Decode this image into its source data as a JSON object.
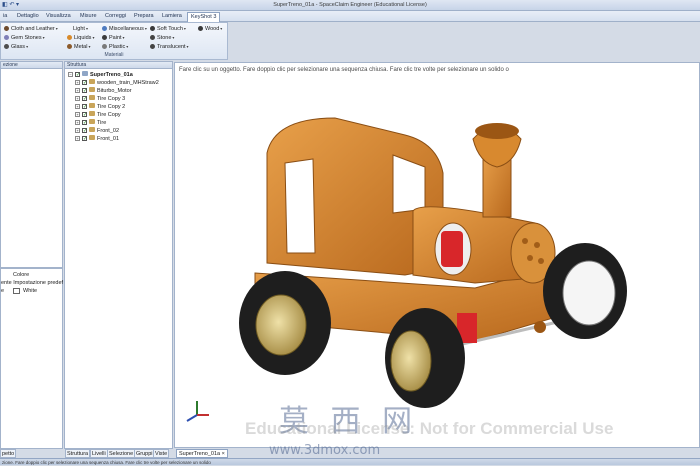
{
  "window": {
    "title": "SuperTreno_01a - SpaceClaim Engineer (Educational License)"
  },
  "menu": {
    "tabs": [
      "Dettaglio",
      "Visualizza",
      "Misure",
      "Correggi",
      "Prepara",
      "Lamiera",
      "KeyShot 3"
    ],
    "cut_left": "ia"
  },
  "ribbon": {
    "group_label": "Materiali",
    "materials": [
      {
        "label": "Cloth and Leather",
        "color": "#6e4a2c"
      },
      {
        "label": "Light",
        "color": ""
      },
      {
        "label": "Miscellaneous",
        "color": "#4f7cc0"
      },
      {
        "label": "Soft Touch",
        "color": "#3a3a3a"
      },
      {
        "label": "Wood",
        "color": "#3b3b3b"
      },
      {
        "label": "Gem Stones",
        "color": "#7f7fb8"
      },
      {
        "label": "Liquids",
        "color": "#d88a2a"
      },
      {
        "label": "Paint",
        "color": "#3b3b3b"
      },
      {
        "label": "Stone",
        "color": "#444444"
      },
      {
        "label": "Glass",
        "color": "#4d4d4d"
      },
      {
        "label": "Metal",
        "color": "#8c5a2b"
      },
      {
        "label": "Plastic",
        "color": "#7a7a7a"
      },
      {
        "label": "Translucent",
        "color": "#444444"
      }
    ]
  },
  "left_panel": {
    "header": "ezione",
    "props": {
      "header": "Colore",
      "row1": "ente Impostazione predef",
      "row2_prefix": "e",
      "row2_value": "White"
    },
    "tabs": [
      "petto"
    ]
  },
  "structure_panel": {
    "header": "Struttura",
    "root": "SuperTreno_01a",
    "items": [
      "wooden_train_MHStraw2",
      "Biturbo_Motor",
      "Tire Copy 3",
      "Tire Copy 2",
      "Tire Copy",
      "Tire",
      "Front_02",
      "Front_01"
    ],
    "bottom_tabs": [
      "Struttura",
      "Livelli",
      "Selezione",
      "Gruppi",
      "Viste"
    ]
  },
  "viewport": {
    "hint": "Fare clic su un oggetto. Fare doppio clic per selezionare una sequenza chiusa. Fare clic tre volte per selezionare un solido o",
    "doc_tab": "SuperTreno_01a",
    "watermark": "Educational License: Not for Commercial Use",
    "site_logo": "莫 西 网",
    "site_url": "www.3dmox.com"
  },
  "colors": {
    "body_wood": "#d6892e",
    "tire": "#1e1e1e",
    "rim": "#c9b06a",
    "suspension": "#d8262a"
  },
  "statusbar": {
    "text": "zione. Fare doppio clic per selezionare una sequenza chiusa. Fare clic tre volte per selezionare un solido"
  }
}
